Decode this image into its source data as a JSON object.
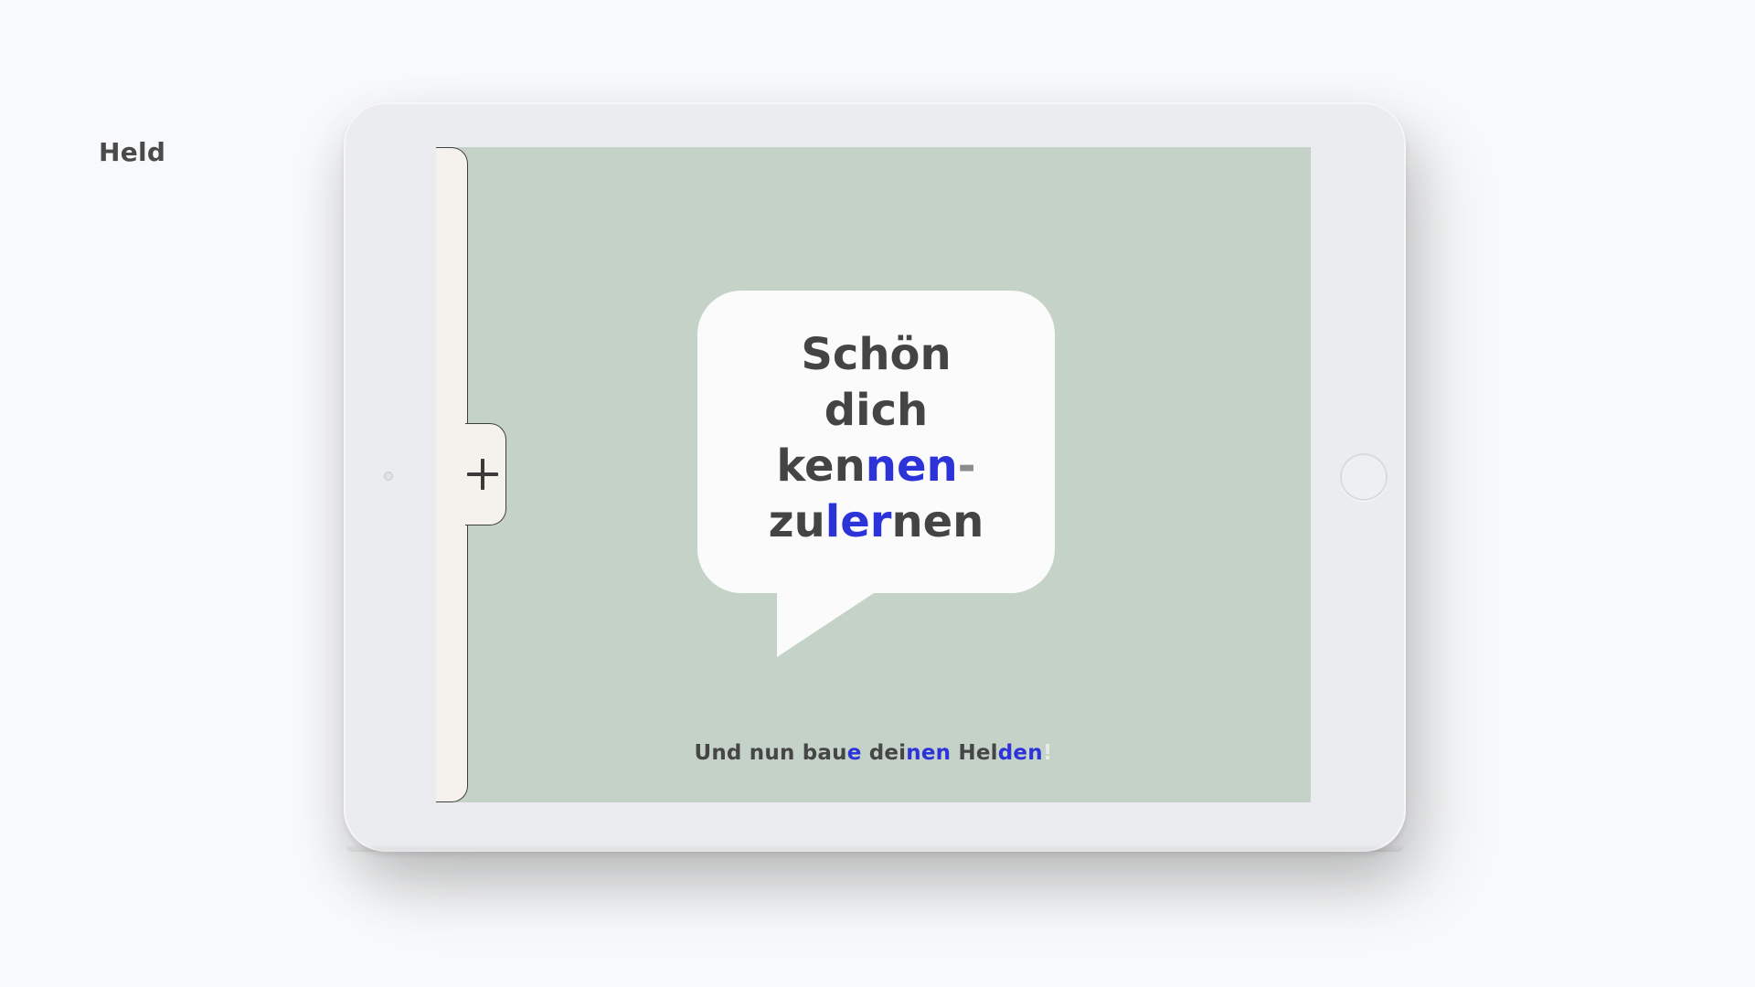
{
  "page": {
    "label": "Held"
  },
  "colors": {
    "screen_background": "#c5d2c7",
    "highlight": "#2b33d9",
    "text": "#444444",
    "drawer": "#f5f2ee"
  },
  "drawer": {
    "icon": "plus-icon"
  },
  "bubble": {
    "line1": "Schön",
    "line2": "dich",
    "line3_a": "ken",
    "line3_b": "nen",
    "line3_c": "-",
    "line4_a": "zu",
    "line4_b": "ler",
    "line4_c": "nen"
  },
  "footer": {
    "part1": "Und nun bau",
    "part2": "e",
    "part3": " dei",
    "part4": "nen",
    "part5": " Hel",
    "part6": "den",
    "part7": "!"
  }
}
